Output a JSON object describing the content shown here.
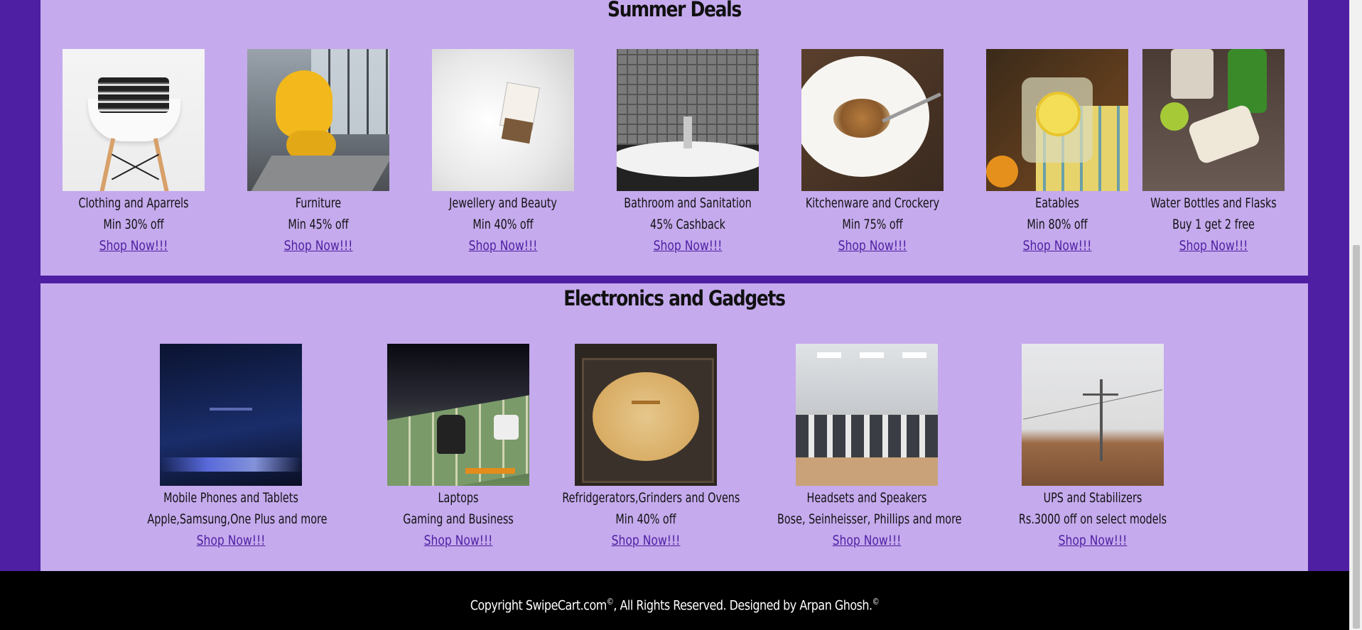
{
  "sections": {
    "summer": {
      "title": "Summer Deals",
      "items": [
        {
          "name": "Clothing and Aparrels",
          "offer": "Min 30% off",
          "link": "Shop Now!!!",
          "image": "clothing-photo"
        },
        {
          "name": "Furniture",
          "offer": "Min 45% off",
          "link": "Shop Now!!!",
          "image": "furniture-photo"
        },
        {
          "name": "Jewellery and Beauty",
          "offer": "Min 40% off",
          "link": "Shop Now!!!",
          "image": "jewellery-photo"
        },
        {
          "name": "Bathroom and Sanitation",
          "offer": "45% Cashback",
          "link": "Shop Now!!!",
          "image": "bathroom-photo"
        },
        {
          "name": "Kitchenware and Crockery",
          "offer": "Min 75% off",
          "link": "Shop Now!!!",
          "image": "kitchenware-photo"
        },
        {
          "name": "Eatables",
          "offer": "Min 80% off",
          "link": "Shop Now!!!",
          "image": "eatables-photo"
        },
        {
          "name": "Water Bottles and Flasks",
          "offer": "Buy 1 get 2 free",
          "link": "Shop Now!!!",
          "image": "water-bottles-photo"
        }
      ]
    },
    "electronics": {
      "title": "Electronics and Gadgets",
      "items": [
        {
          "name": "Mobile Phones and Tablets",
          "offer": "Apple,Samsung,One Plus and more",
          "link": "Shop Now!!!",
          "image": "mobile-photo"
        },
        {
          "name": "Laptops",
          "offer": "Gaming and Business",
          "link": "Shop Now!!!",
          "image": "laptops-photo"
        },
        {
          "name": "Refridgerators,Grinders and Ovens",
          "offer": "Min 40% off",
          "link": "Shop Now!!!",
          "image": "refrigerators-photo"
        },
        {
          "name": "Headsets and Speakers",
          "offer": "Bose, Seinheisser, Phillips and more",
          "link": "Shop Now!!!",
          "image": "headsets-photo"
        },
        {
          "name": "UPS and Stabilizers",
          "offer": "Rs.3000 off on select models",
          "link": "Shop Now!!!",
          "image": "ups-photo"
        }
      ]
    }
  },
  "footer": {
    "copyright_prefix": "Copyright SwipeCart.com",
    "copyright_symbol": "©",
    "copyright_middle": ", All Rights Reserved. Designed by Arpan Ghosh.",
    "copyright_symbol_2": "©"
  },
  "colors": {
    "page_background": "#4f1fa3",
    "panel_background": "#c5aaed",
    "link": "#4f1fa3",
    "footer_background": "#000000",
    "footer_text": "#ffffff"
  }
}
